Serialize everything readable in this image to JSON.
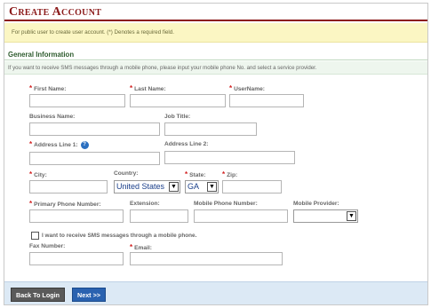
{
  "header": {
    "title": "Create Account"
  },
  "notice": "For public user to create user account. (*) Denotes a required field.",
  "section": {
    "title": "General Information",
    "note": "If you want to receive SMS messages through a mobile phone, please input your mobile phone No. and select a service provider."
  },
  "required_mark": "*",
  "fields": {
    "first_name": "First Name:",
    "last_name": "Last Name:",
    "username": "UserName:",
    "business_name": "Business Name:",
    "job_title": "Job Title:",
    "address1": "Address Line 1:",
    "address2": "Address Line 2:",
    "city": "City:",
    "country": "Country:",
    "state": "State:",
    "zip": "Zip:",
    "primary_phone": "Primary Phone Number:",
    "extension": "Extension:",
    "mobile_phone": "Mobile Phone Number:",
    "mobile_provider": "Mobile Provider:",
    "fax": "Fax Number:",
    "email": "Email:"
  },
  "selects": {
    "country_value": "United States",
    "state_value": "GA",
    "provider_value": ""
  },
  "help_glyph": "?",
  "arrow_glyph": "▼",
  "sms_checkbox_label": "I want to receive SMS messages through a mobile phone.",
  "buttons": {
    "back": "Back To Login",
    "next": "Next >>"
  },
  "colors": {
    "title": "#8b1a1a",
    "notice_bg": "#fbf6c3",
    "section_title": "#2e5c2e",
    "required": "#d21f1f",
    "footer_bg": "#dce9f5",
    "next_button": "#2a62b0",
    "back_button": "#5a5a5a"
  }
}
